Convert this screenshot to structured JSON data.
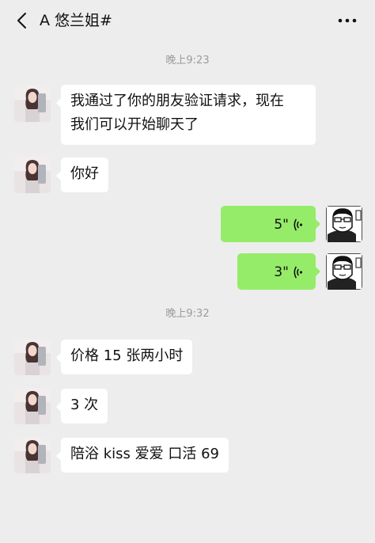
{
  "header": {
    "title": "A 悠兰姐#",
    "back_icon": "chevron-left-icon",
    "more_icon": "more-horizontal-icon"
  },
  "timestamps": [
    "晚上9:23",
    "晚上9:32"
  ],
  "messages": [
    {
      "side": "left",
      "type": "text",
      "text_lines": [
        "我通过了你的朋友验证请求，现在",
        "我们可以开始聊天了"
      ]
    },
    {
      "side": "left",
      "type": "text",
      "text": "你好"
    },
    {
      "side": "right",
      "type": "voice",
      "duration": "5\""
    },
    {
      "side": "right",
      "type": "voice",
      "duration": "3\""
    },
    {
      "side": "left",
      "type": "text",
      "text": "价格 15 张两小时"
    },
    {
      "side": "left",
      "type": "text",
      "text": "3 次"
    },
    {
      "side": "left",
      "type": "text",
      "text": "陪浴 kiss 爱爱 口活 69"
    }
  ],
  "colors": {
    "background": "#ededed",
    "incoming_bubble": "#ffffff",
    "outgoing_bubble": "#95ec69",
    "timestamp_text": "#9b9b9b"
  }
}
